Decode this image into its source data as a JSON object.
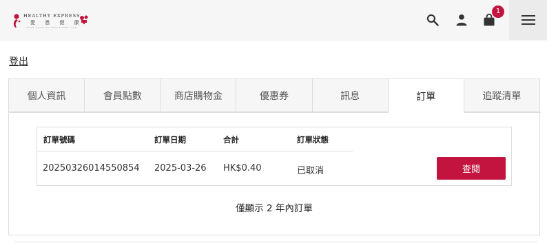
{
  "header": {
    "logo_en": "HEALTHY EXPRESS",
    "logo_zh": "愛 悉 健 康",
    "logo_tagline": "YOUR LOVE OF HEALTHIER LIFE",
    "cart_count": "1"
  },
  "account": {
    "logout_label": "登出"
  },
  "tabs": [
    {
      "label": "個人資訊"
    },
    {
      "label": "會員點數"
    },
    {
      "label": "商店購物金"
    },
    {
      "label": "優惠券"
    },
    {
      "label": "訊息"
    },
    {
      "label": "訂單"
    },
    {
      "label": "追蹤清單"
    }
  ],
  "orders": {
    "columns": [
      "訂單號碼",
      "訂單日期",
      "合計",
      "訂單狀態"
    ],
    "rows": [
      {
        "order_no": "20250326014550854",
        "date": "2025-03-26",
        "total": "HK$0.40",
        "status": "已取消",
        "action": "查閱"
      }
    ],
    "note": "僅顯示 2 年內訂單"
  },
  "colors": {
    "accent": "#c2143e",
    "header_bg": "#f6f6f6"
  }
}
